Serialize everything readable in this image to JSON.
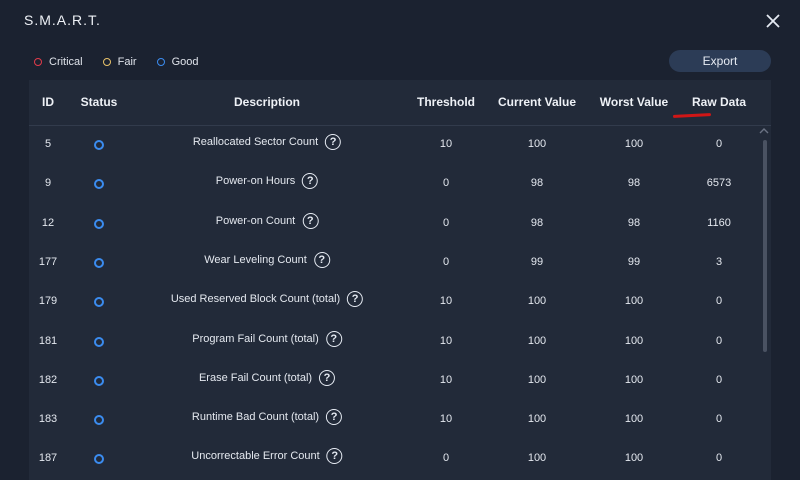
{
  "window": {
    "title": "S.M.A.R.T."
  },
  "legend": [
    {
      "label": "Critical",
      "color": "#e23b4a"
    },
    {
      "label": "Fair",
      "color": "#e8c26a"
    },
    {
      "label": "Good",
      "color": "#3b8cf0"
    }
  ],
  "export_label": "Export",
  "columns": {
    "id": "ID",
    "status": "Status",
    "description": "Description",
    "threshold": "Threshold",
    "current": "Current Value",
    "worst": "Worst Value",
    "raw": "Raw Data"
  },
  "status_color": "#3b8cf0",
  "rows": [
    {
      "id": "5",
      "status": "Good",
      "description": "Reallocated Sector Count",
      "threshold": "10",
      "current": "100",
      "worst": "100",
      "raw": "0"
    },
    {
      "id": "9",
      "status": "Good",
      "description": "Power-on Hours",
      "threshold": "0",
      "current": "98",
      "worst": "98",
      "raw": "6573"
    },
    {
      "id": "12",
      "status": "Good",
      "description": "Power-on Count",
      "threshold": "0",
      "current": "98",
      "worst": "98",
      "raw": "1160"
    },
    {
      "id": "177",
      "status": "Good",
      "description": "Wear Leveling Count",
      "threshold": "0",
      "current": "99",
      "worst": "99",
      "raw": "3"
    },
    {
      "id": "179",
      "status": "Good",
      "description": "Used Reserved Block Count (total)",
      "threshold": "10",
      "current": "100",
      "worst": "100",
      "raw": "0"
    },
    {
      "id": "181",
      "status": "Good",
      "description": "Program Fail Count (total)",
      "threshold": "10",
      "current": "100",
      "worst": "100",
      "raw": "0"
    },
    {
      "id": "182",
      "status": "Good",
      "description": "Erase Fail Count (total)",
      "threshold": "10",
      "current": "100",
      "worst": "100",
      "raw": "0"
    },
    {
      "id": "183",
      "status": "Good",
      "description": "Runtime Bad Count (total)",
      "threshold": "10",
      "current": "100",
      "worst": "100",
      "raw": "0"
    },
    {
      "id": "187",
      "status": "Good",
      "description": "Uncorrectable Error Count",
      "threshold": "0",
      "current": "100",
      "worst": "100",
      "raw": "0"
    }
  ]
}
